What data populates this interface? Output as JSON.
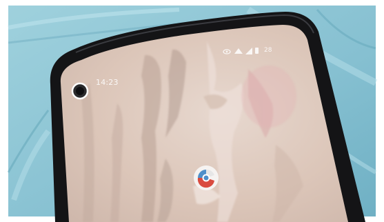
{
  "status_bar": {
    "time": "14:23",
    "battery_percent": "28",
    "icons": [
      "eye-icon",
      "wifi-icon",
      "cell-signal-icon",
      "battery-icon"
    ]
  },
  "home_screen": {
    "app_icon": "chrome-style-circle-app-icon"
  },
  "colors": {
    "mask_blue": "#8ec7d6",
    "phone_bezel": "#141416",
    "wallpaper_beige": "#ddc9bd",
    "icon_red": "#d94b3f",
    "icon_blue": "#4f8fc9"
  }
}
